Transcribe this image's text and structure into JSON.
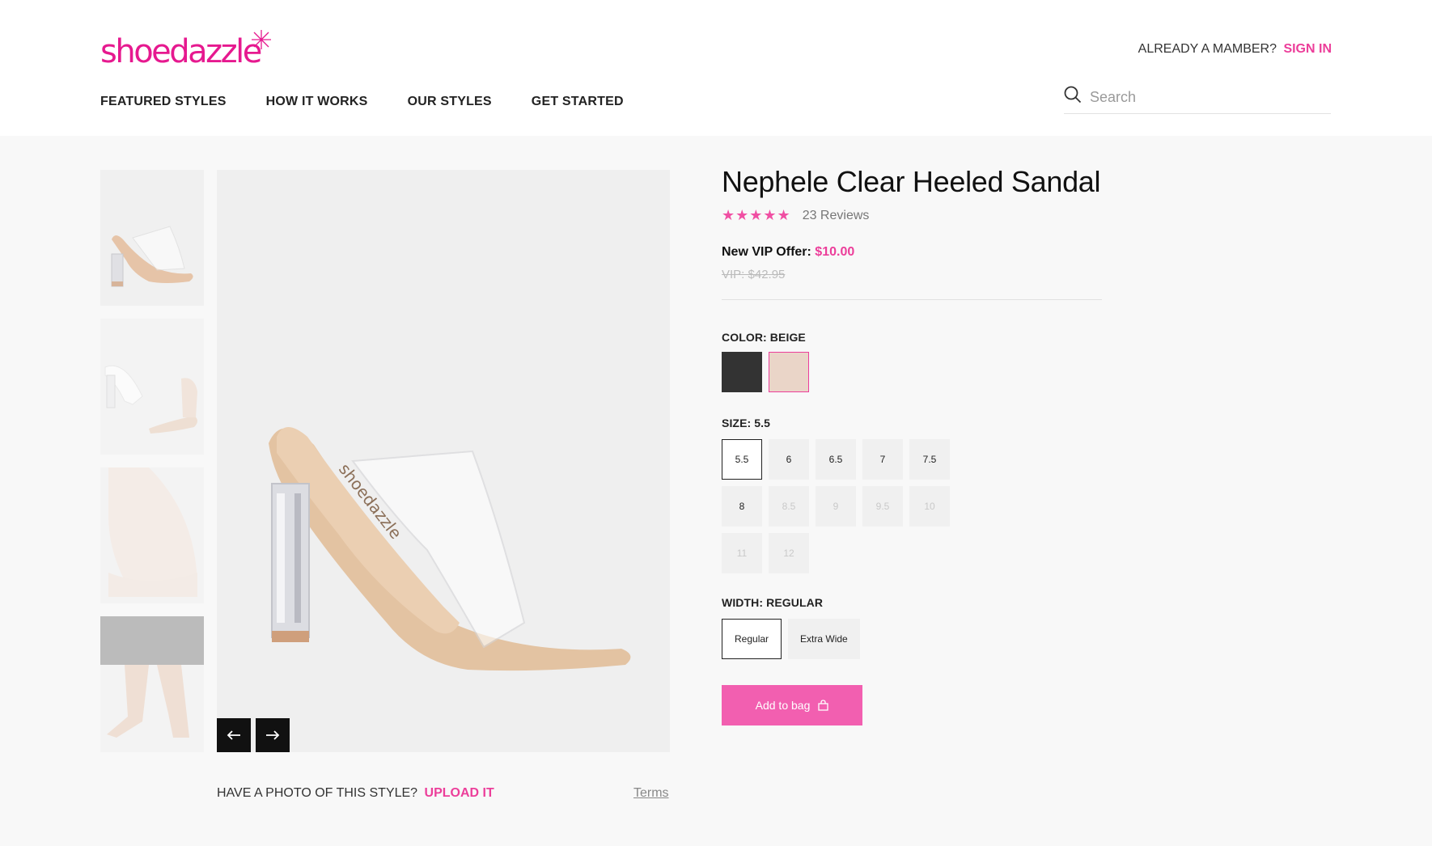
{
  "brand": {
    "logo_text": "shoedazzle",
    "accent": "#ec3e9a"
  },
  "header": {
    "member_prompt": "ALREADY A MAMBER?",
    "sign_in": "SIGN IN",
    "nav": [
      "FEATURED STYLES",
      "HOW IT WORKS",
      "OUR STYLES",
      "GET STARTED"
    ],
    "search_placeholder": "Search",
    "search_icon": "search-icon"
  },
  "gallery": {
    "prev_icon": "arrow-left-icon",
    "next_icon": "arrow-right-icon",
    "photo_prompt": "HAVE A PHOTO OF THIS STYLE?",
    "upload_label": "UPLOAD IT",
    "terms_label": "Terms"
  },
  "product": {
    "name": "Nephele Clear Heeled Sandal",
    "rating_stars": 5,
    "stars_text": "★★★★★",
    "reviews": "23 Reviews",
    "offer_label": "New VIP Offer:",
    "offer_price": "$10.00",
    "vip_price": "VIP: $42.95",
    "color_label": "COLOR: BEIGE",
    "colors": [
      {
        "name": "black",
        "hex": "#333333"
      },
      {
        "name": "beige",
        "hex": "#ead5c8",
        "selected": true
      }
    ],
    "size_label": "SIZE: 5.5",
    "sizes": [
      {
        "label": "5.5",
        "selected": true,
        "available": true
      },
      {
        "label": "6",
        "available": true
      },
      {
        "label": "6.5",
        "available": true
      },
      {
        "label": "7",
        "available": true
      },
      {
        "label": "7.5",
        "available": true
      },
      {
        "label": "8",
        "available": true
      },
      {
        "label": "8.5",
        "available": false
      },
      {
        "label": "9",
        "available": false
      },
      {
        "label": "9.5",
        "available": false
      },
      {
        "label": "10",
        "available": false
      },
      {
        "label": "11",
        "available": false
      },
      {
        "label": "12",
        "available": false
      }
    ],
    "width_label": "WIDTH: REGULAR",
    "widths": [
      {
        "label": "Regular",
        "selected": true
      },
      {
        "label": "Extra Wide",
        "selected": false
      }
    ],
    "add_to_bag": "Add to bag",
    "bag_icon": "shopping-bag-icon"
  }
}
